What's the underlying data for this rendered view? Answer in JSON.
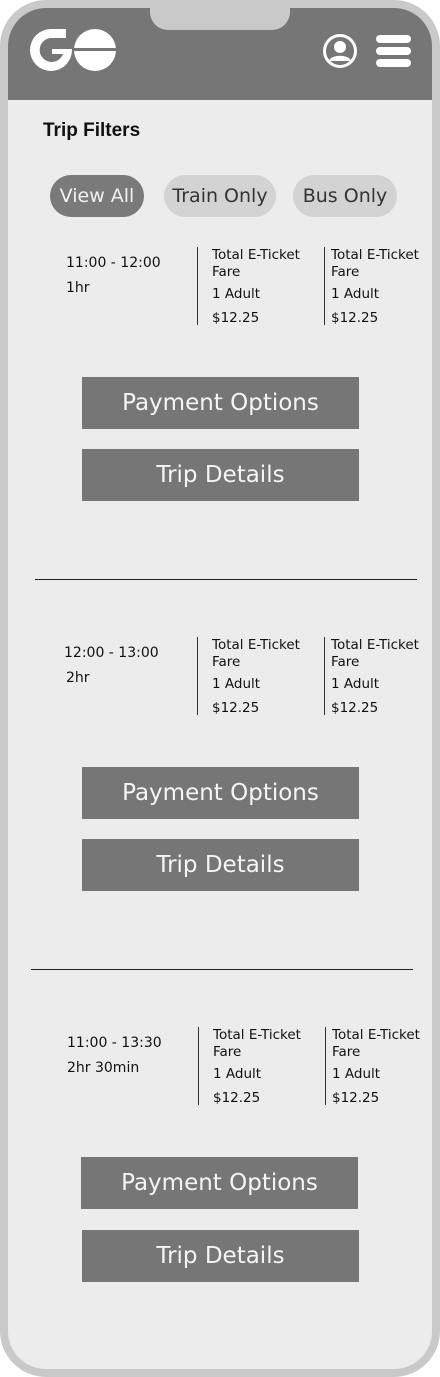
{
  "header": {
    "logo_icon": "go-transit-logo",
    "profile_icon": "user-profile-icon",
    "menu_icon": "hamburger-menu-icon",
    "background_color": "#767676"
  },
  "filters": {
    "title": "Trip Filters",
    "options": [
      {
        "label": "View All",
        "active": true
      },
      {
        "label": "Train Only",
        "active": false
      },
      {
        "label": "Bus Only",
        "active": false
      }
    ]
  },
  "trips": [
    {
      "time": "11:00 - 12:00",
      "duration": "1hr",
      "fares": [
        {
          "title": "Total E-Ticket Fare",
          "passengers": "1 Adult",
          "price": "$12.25"
        },
        {
          "title": "Total E-Ticket Fare",
          "passengers": "1 Adult",
          "price": "$12.25"
        }
      ],
      "payment_label": "Payment Options",
      "details_label": "Trip Details"
    },
    {
      "time": "12:00 - 13:00",
      "duration": "2hr",
      "fares": [
        {
          "title": "Total E-Ticket Fare",
          "passengers": "1 Adult",
          "price": "$12.25"
        },
        {
          "title": "Total E-Ticket Fare",
          "passengers": "1 Adult",
          "price": "$12.25"
        }
      ],
      "payment_label": "Payment Options",
      "details_label": "Trip Details"
    },
    {
      "time": "11:00 - 13:30",
      "duration": "2hr 30min",
      "fares": [
        {
          "title": "Total E-Ticket Fare",
          "passengers": "1 Adult",
          "price": "$12.25"
        },
        {
          "title": "Total E-Ticket Fare",
          "passengers": "1 Adult",
          "price": "$12.25"
        }
      ],
      "payment_label": "Payment Options",
      "details_label": "Trip Details"
    }
  ]
}
